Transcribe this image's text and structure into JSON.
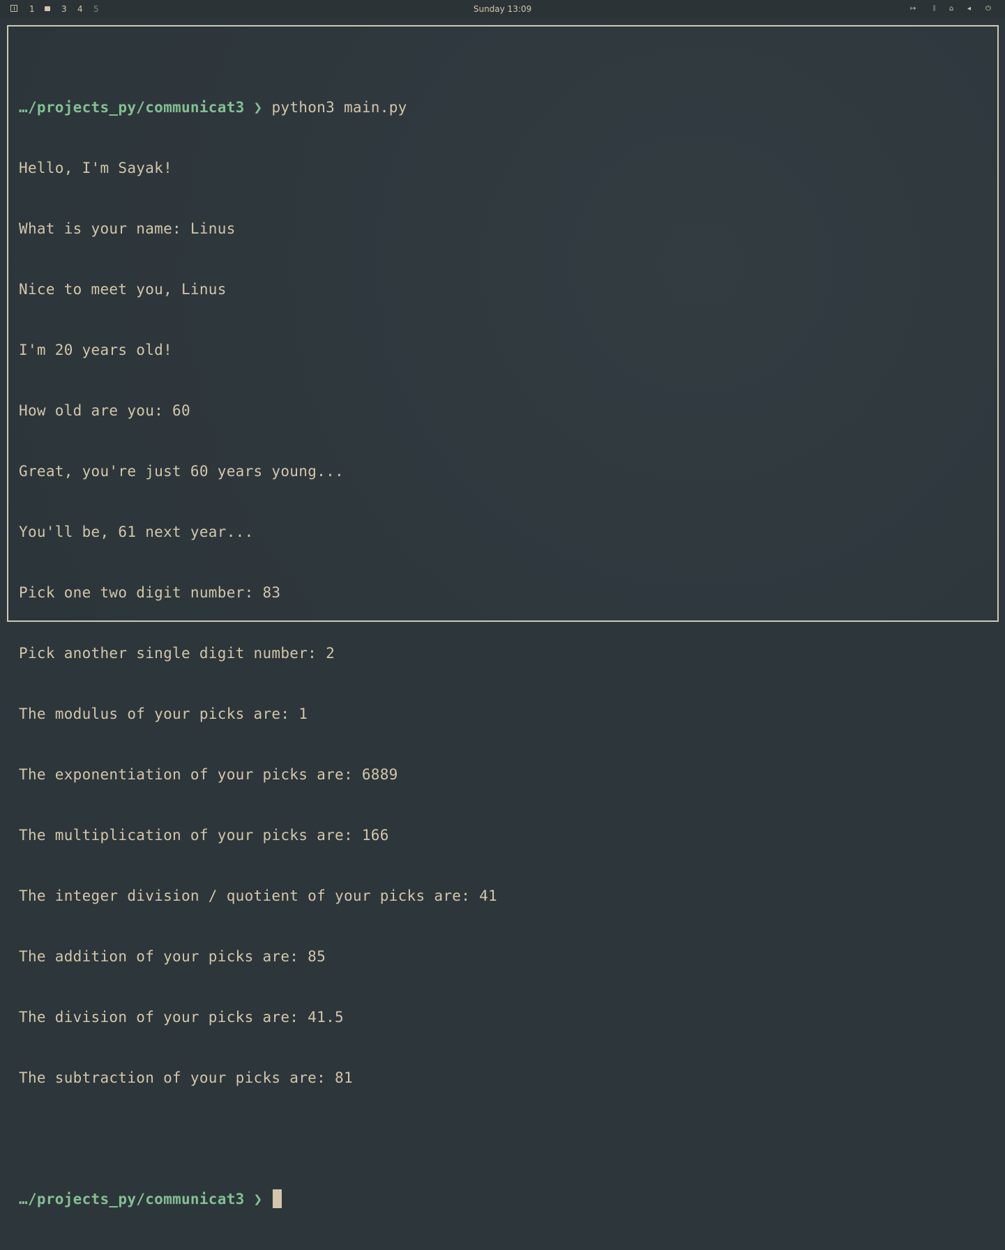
{
  "topbar": {
    "workspaces": [
      {
        "label": "1",
        "state": "normal"
      },
      {
        "label": "",
        "state": "active"
      },
      {
        "label": "3",
        "state": "normal"
      },
      {
        "label": "4",
        "state": "normal"
      },
      {
        "label": "5",
        "state": "dim"
      }
    ],
    "clock": "Sunday 13:09",
    "tray_icons": [
      "logout-icon",
      "bluetooth-icon",
      "network-icon",
      "volume-icon",
      "power-icon"
    ]
  },
  "terminal": {
    "prompt_path": "…/projects_py/communicat3",
    "prompt_symbol": "❯",
    "command": "python3 main.py",
    "output": [
      "Hello, I'm Sayak!",
      "What is your name: Linus",
      "Nice to meet you, Linus",
      "I'm 20 years old!",
      "How old are you: 60",
      "Great, you're just 60 years young...",
      "You'll be, 61 next year...",
      "Pick one two digit number: 83",
      "Pick another single digit number: 2",
      "The modulus of your picks are: 1",
      "The exponentiation of your picks are: 6889",
      "The multiplication of your picks are: 166",
      "The integer division / quotient of your picks are: 41",
      "The addition of your picks are: 85",
      "The division of your picks are: 41.5",
      "The subtraction of your picks are: 81"
    ]
  }
}
